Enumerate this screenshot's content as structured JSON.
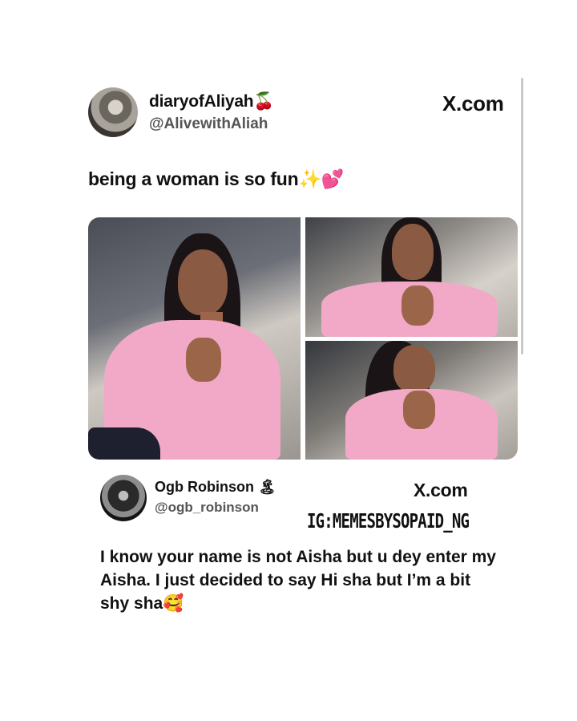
{
  "tweet1": {
    "display_name": "diaryofAliyah🍒",
    "handle": "@AlivewithAliah",
    "brand": "X.com",
    "text": "being a woman is so fun✨💕"
  },
  "tweet2": {
    "display_name": "Ogb Robinson 🏝",
    "handle": "@ogb_robinson",
    "brand": "X.com",
    "watermark": "IG:MEMESBYSOPAID_NG",
    "text": "I know your name is not Aisha but u dey enter my Aisha. I just decided to say Hi sha but I’m a bit shy sha🥰"
  }
}
